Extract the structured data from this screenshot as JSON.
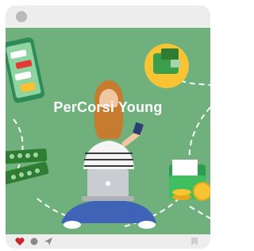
{
  "post": {
    "image_text": "PerCorsi Young",
    "icons": {
      "avatar": "avatar-placeholder",
      "like": "heart-icon",
      "comment": "comment-icon",
      "share": "send-icon",
      "save": "bookmark-icon"
    }
  },
  "colors": {
    "card_background": "#ededed",
    "image_background": "#6fb07c",
    "heart": "#c62828",
    "footer_icons": "#8a8a8a"
  }
}
